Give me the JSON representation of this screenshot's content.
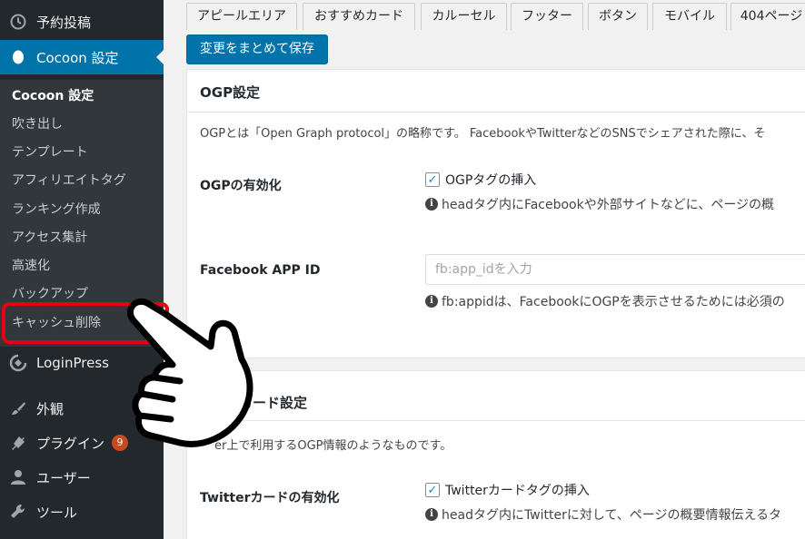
{
  "sidebar": {
    "top_items": [
      {
        "label": "予約投稿",
        "icon": "clock-icon"
      },
      {
        "label": "Cocoon 設定",
        "icon": "cocoon-icon"
      }
    ],
    "submenu": [
      {
        "label": "Cocoon 設定"
      },
      {
        "label": "吹き出し"
      },
      {
        "label": "テンプレート"
      },
      {
        "label": "アフィリエイトタグ"
      },
      {
        "label": "ランキング作成"
      },
      {
        "label": "アクセス集計"
      },
      {
        "label": "高速化"
      },
      {
        "label": "バックアップ"
      },
      {
        "label": "キャッシュ削除"
      }
    ],
    "bottom_items": [
      {
        "label": "LoginPress",
        "icon": "loginpress-icon"
      },
      {
        "label": "外観",
        "icon": "brush-icon"
      },
      {
        "label": "プラグイン",
        "icon": "plugin-icon",
        "badge": "9"
      },
      {
        "label": "ユーザー",
        "icon": "user-icon"
      },
      {
        "label": "ツール",
        "icon": "wrench-icon"
      }
    ]
  },
  "tabs": [
    "アピールエリア",
    "おすすめカード",
    "カルーセル",
    "フッター",
    "ボタン",
    "モバイル",
    "404ページ"
  ],
  "save_button": "変更をまとめて保存",
  "ogp": {
    "title": "OGP設定",
    "description": "OGPとは「Open Graph protocol」の略称です。 FacebookやTwitterなどのSNSでシェアされた際に、そ",
    "enable_label": "OGPの有効化",
    "enable_checkbox": "OGPタグの挿入",
    "enable_info": "headタグ内にFacebookや外部サイトなどに、ページの概",
    "appid_label": "Facebook APP ID",
    "appid_placeholder": "fb:app_idを入力",
    "appid_info": "fb:appidは、FacebookにOGPを表示させるためには必須の"
  },
  "twitter": {
    "title": "カード設定",
    "description": "er上で利用するOGP情報のようなものです。",
    "enable_label": "Twitterカードの有効化",
    "enable_checkbox": "Twitterカードタグの挿入",
    "enable_info": "headタグ内にTwitterに対して、ページの概要情報伝えるタ"
  },
  "colors": {
    "sidebar_bg": "#23282d",
    "submenu_bg": "#32373c",
    "accent": "#0073aa",
    "highlight": "#e60012",
    "badge": "#ca4a1f"
  }
}
